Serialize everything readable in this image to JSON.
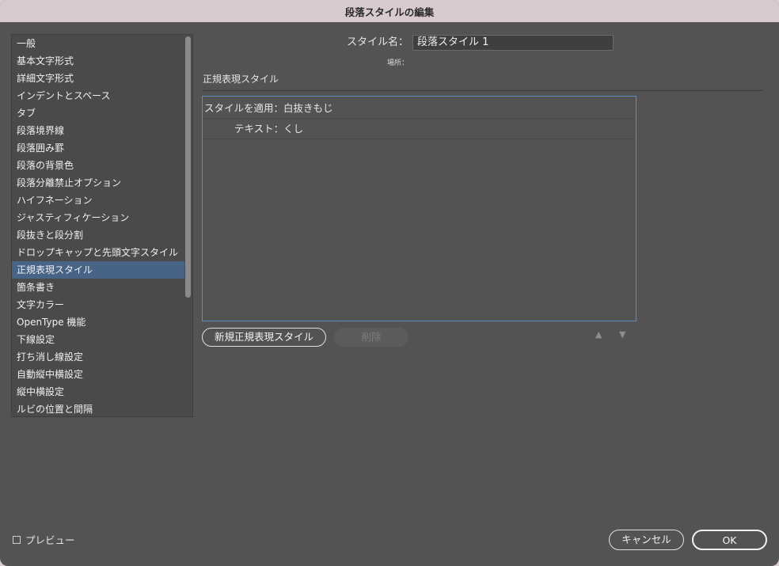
{
  "window": {
    "title": "段落スタイルの編集"
  },
  "sidebar": {
    "selected_index": 13,
    "items": [
      "一般",
      "基本文字形式",
      "詳細文字形式",
      "インデントとスペース",
      "タブ",
      "段落境界線",
      "段落囲み罫",
      "段落の背景色",
      "段落分離禁止オプション",
      "ハイフネーション",
      "ジャスティフィケーション",
      "段抜きと段分割",
      "ドロップキャップと先頭文字スタイル",
      "正規表現スタイル",
      "箇条書き",
      "文字カラー",
      "OpenType 機能",
      "下線設定",
      "打ち消し線設定",
      "自動縦中横設定",
      "縦中横設定",
      "ルビの位置と間隔"
    ]
  },
  "form": {
    "style_name_label": "スタイル名：",
    "style_name_value": "段落スタイル 1",
    "location_label": "場所："
  },
  "panel": {
    "section_title": "正規表現スタイル",
    "rule": {
      "apply_style": "スタイルを適用：白抜きもじ",
      "text": "テキスト：くし"
    },
    "new_button_label": "新規正規表現スタイル",
    "delete_button_label": "削除",
    "move_up_icon": "triangle-up-icon",
    "move_down_icon": "triangle-down-icon"
  },
  "footer": {
    "preview_label": "プレビュー",
    "preview_checked": false,
    "cancel_label": "キャンセル",
    "ok_label": "OK"
  },
  "colors": {
    "background": "#535353",
    "selection": "#476386",
    "focus_border": "#5d8fc5"
  }
}
